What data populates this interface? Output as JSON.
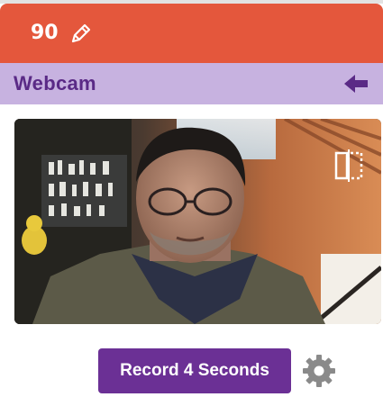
{
  "header": {
    "number": "90",
    "edit_icon": "pencil-icon",
    "color": "#e4573c"
  },
  "title_bar": {
    "title": "Webcam",
    "back_icon": "arrow-left-icon",
    "color": "#c7b2e0",
    "text_color": "#5a2a86"
  },
  "webcam": {
    "flip_icon": "mirror-flip-icon"
  },
  "controls": {
    "record_label": "Record 4 Seconds",
    "record_color": "#6b3095",
    "settings_icon": "gear-icon"
  }
}
